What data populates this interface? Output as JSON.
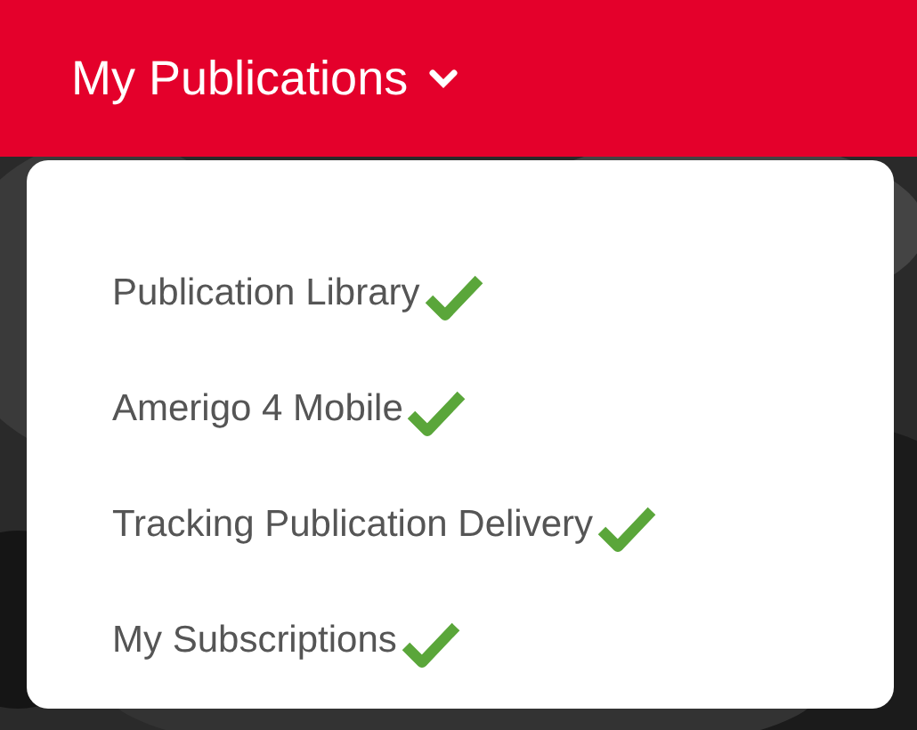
{
  "header": {
    "title": "My Publications"
  },
  "menu": {
    "items": [
      {
        "label": "Publication Library",
        "checked": true
      },
      {
        "label": "Amerigo 4 Mobile",
        "checked": true
      },
      {
        "label": "Tracking Publication Delivery",
        "checked": true
      },
      {
        "label": "My Subscriptions",
        "checked": true
      }
    ]
  }
}
